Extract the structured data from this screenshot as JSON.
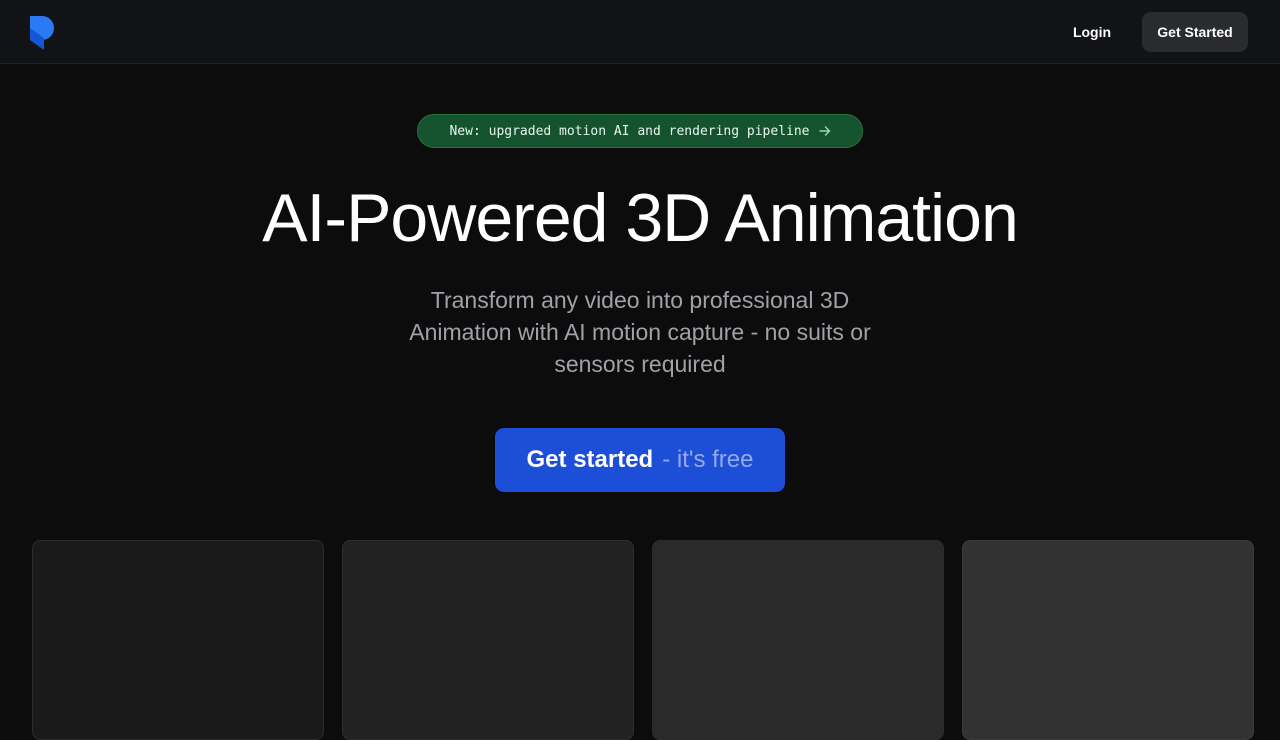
{
  "nav": {
    "logo_icon": "brand-logo-icon",
    "login_label": "Login",
    "cta_label": "Get Started"
  },
  "hero": {
    "announcement": {
      "text": "New: upgraded motion AI and rendering pipeline",
      "icon": "arrow-right-icon"
    },
    "title": "AI-Powered 3D Animation",
    "subtitle": "Transform any video into professional 3D Animation with AI motion capture - no suits or sensors required",
    "cta": {
      "main": "Get started",
      "sub": "- it's free"
    }
  },
  "colors": {
    "background": "#0c0c0c",
    "navbar": "#121316",
    "accent_blue": "#1d4ed8",
    "logo_blue": "#1a6cf0",
    "badge_green": "#14532d",
    "muted_text": "#a1a1aa"
  }
}
